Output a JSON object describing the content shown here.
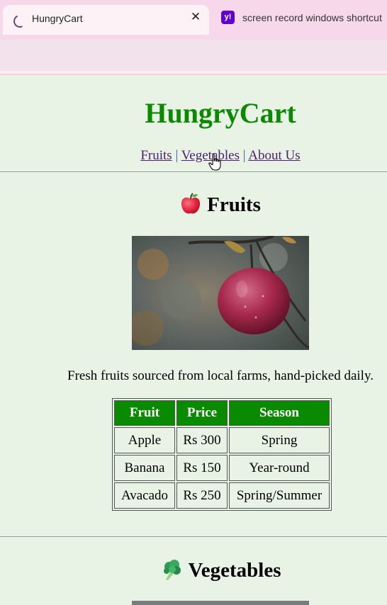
{
  "browser": {
    "active_tab": {
      "title": "HungryCart"
    },
    "inactive_tab": {
      "title": "screen record windows shortcut",
      "favicon_label": "y!"
    },
    "close_glyph": "✕"
  },
  "site": {
    "title": "HungryCart",
    "nav": [
      {
        "label": "Fruits"
      },
      {
        "label": "Vegetables"
      },
      {
        "label": "About Us"
      }
    ],
    "nav_separator": "|"
  },
  "fruits": {
    "heading": "Fruits",
    "icon": "apple-icon",
    "description": "Fresh fruits sourced from local farms, hand-picked daily.",
    "table": {
      "headers": [
        "Fruit",
        "Price",
        "Season"
      ],
      "rows": [
        [
          "Apple",
          "Rs 300",
          "Spring"
        ],
        [
          "Banana",
          "Rs 150",
          "Year-round"
        ],
        [
          "Avacado",
          "Rs 250",
          "Spring/Summer"
        ]
      ]
    }
  },
  "vegetables": {
    "heading": "Vegetables",
    "icon": "broccoli-icon"
  },
  "colors": {
    "page_bg": "#e8f3e6",
    "title_green": "#0a8a00",
    "table_header_bg": "#0a8a00",
    "link_purple": "#4b1f6e"
  }
}
